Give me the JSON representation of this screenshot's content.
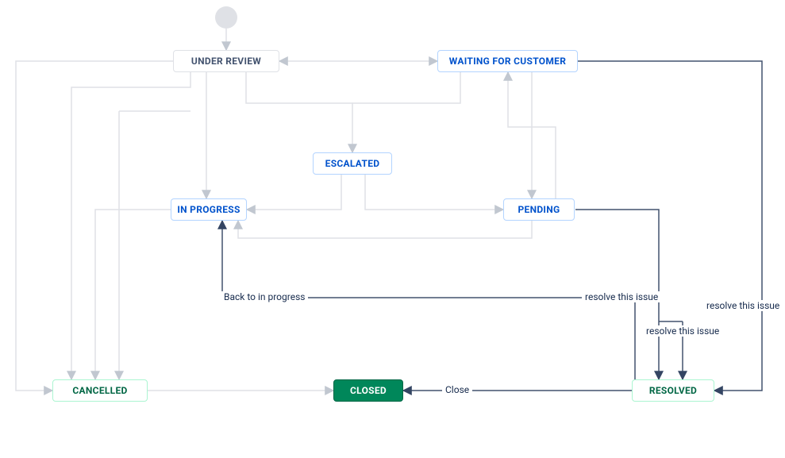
{
  "diagram": {
    "type": "workflow",
    "start_node": true,
    "states": {
      "under_review": {
        "label": "UNDER REVIEW",
        "category": "todo"
      },
      "waiting_for_customer": {
        "label": "WAITING FOR CUSTOMER",
        "category": "in_progress"
      },
      "escalated": {
        "label": "ESCALATED",
        "category": "in_progress"
      },
      "in_progress": {
        "label": "IN PROGRESS",
        "category": "in_progress"
      },
      "pending": {
        "label": "PENDING",
        "category": "in_progress"
      },
      "cancelled": {
        "label": "CANCELLED",
        "category": "done"
      },
      "closed": {
        "label": "CLOSED",
        "category": "done_solid"
      },
      "resolved": {
        "label": "RESOLVED",
        "category": "done"
      }
    },
    "transitions": [
      {
        "from": "start",
        "to": "under_review",
        "label": ""
      },
      {
        "from": "under_review",
        "to": "waiting_for_customer",
        "label": ""
      },
      {
        "from": "waiting_for_customer",
        "to": "under_review",
        "label": ""
      },
      {
        "from": "under_review",
        "to": "escalated",
        "label": ""
      },
      {
        "from": "waiting_for_customer",
        "to": "escalated",
        "label": ""
      },
      {
        "from": "under_review",
        "to": "in_progress",
        "label": ""
      },
      {
        "from": "escalated",
        "to": "in_progress",
        "label": ""
      },
      {
        "from": "escalated",
        "to": "pending",
        "label": ""
      },
      {
        "from": "waiting_for_customer",
        "to": "pending",
        "label": ""
      },
      {
        "from": "pending",
        "to": "in_progress",
        "label": ""
      },
      {
        "from": "pending",
        "to": "waiting_for_customer",
        "label": ""
      },
      {
        "from": "under_review",
        "to": "cancelled",
        "label": ""
      },
      {
        "from": "in_progress",
        "to": "cancelled",
        "label": ""
      },
      {
        "from": "cancelled",
        "to": "closed",
        "label": ""
      },
      {
        "from": "resolved",
        "to": "closed",
        "label": "Close"
      },
      {
        "from": "resolved",
        "to": "in_progress",
        "label": "Back to in progress"
      },
      {
        "from": "in_progress",
        "to": "resolved",
        "label": "resolve this issue"
      },
      {
        "from": "pending",
        "to": "resolved",
        "label": "resolve this issue"
      },
      {
        "from": "waiting_for_customer",
        "to": "resolved",
        "label": "resolve this issue"
      }
    ],
    "edge_labels": {
      "back_to_in_progress": "Back to in progress",
      "resolve_this_issue": "resolve this issue",
      "close": "Close"
    },
    "colors": {
      "edge_light": "#dfe1e6",
      "edge_dark": "#42526e",
      "blue": "#0052cc",
      "green": "#006644",
      "green_fill": "#00875a"
    }
  }
}
